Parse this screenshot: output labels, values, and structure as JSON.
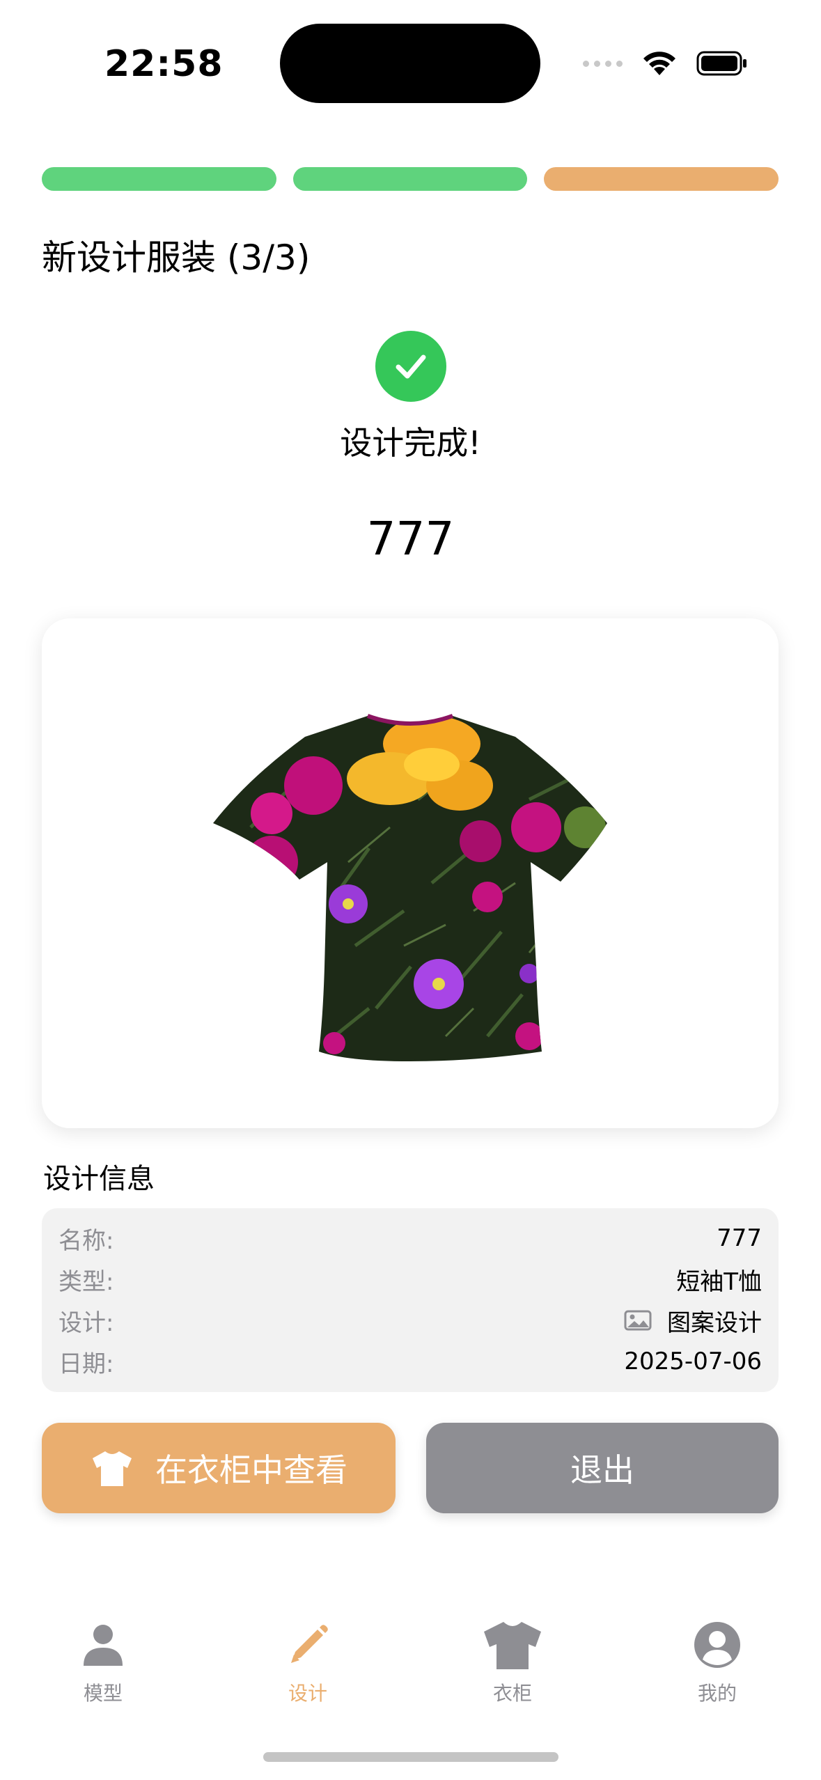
{
  "status_bar": {
    "time": "22:58"
  },
  "progress": {
    "steps_total": 3,
    "current_step": 3,
    "colors": [
      "#5fd37d",
      "#5fd37d",
      "#eaae6f"
    ]
  },
  "header": {
    "title": "新设计服装 (3/3)"
  },
  "completion": {
    "message": "设计完成!",
    "design_name": "777",
    "check_color": "#35c759"
  },
  "preview": {
    "garment_icon": "tshirt-floral-preview"
  },
  "info": {
    "title": "设计信息",
    "rows": [
      {
        "label": "名称:",
        "value": "777"
      },
      {
        "label": "类型:",
        "value": "短袖T恤"
      },
      {
        "label": "设计:",
        "value": "图案设计",
        "icon": "image-icon"
      },
      {
        "label": "日期:",
        "value": "2025-07-06"
      }
    ]
  },
  "actions": {
    "view_in_wardrobe": "在衣柜中查看",
    "exit": "退出",
    "primary_color": "#eaae6f",
    "secondary_color": "#8e8e93"
  },
  "tabbar": {
    "active": "design",
    "active_color": "#eaae6f",
    "inactive_color": "#8e8e93",
    "items": [
      {
        "key": "model",
        "label": "模型",
        "icon": "person-icon"
      },
      {
        "key": "design",
        "label": "设计",
        "icon": "pencil-icon"
      },
      {
        "key": "wardrobe",
        "label": "衣柜",
        "icon": "tshirt-icon"
      },
      {
        "key": "mine",
        "label": "我的",
        "icon": "profile-icon"
      }
    ]
  }
}
